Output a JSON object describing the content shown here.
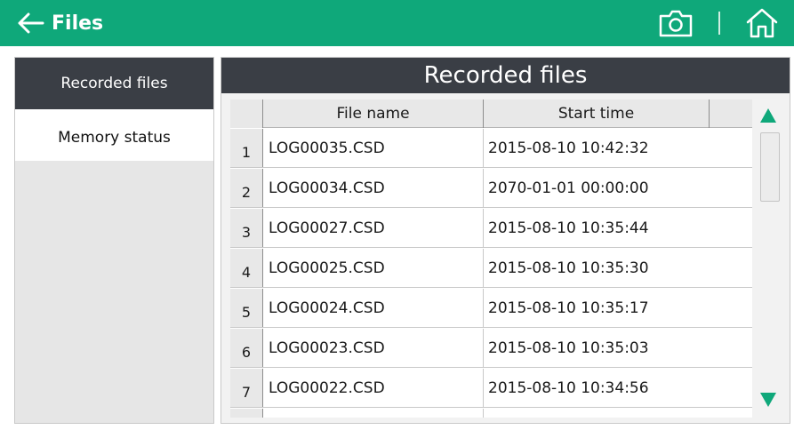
{
  "header": {
    "title": "Files",
    "back_icon": "arrow-left-icon",
    "camera_icon": "camera-icon",
    "home_icon": "home-icon",
    "bg_color": "#0fa87a"
  },
  "sidebar": {
    "items": [
      {
        "label": "Recorded files",
        "active": true
      },
      {
        "label": "Memory status",
        "active": false
      }
    ]
  },
  "main": {
    "title": "Recorded files",
    "table": {
      "columns": [
        "File name",
        "Start time"
      ],
      "rows": [
        {
          "num": "1",
          "file": "LOG00035.CSD",
          "start": "2015-08-10 10:42:32"
        },
        {
          "num": "2",
          "file": "LOG00034.CSD",
          "start": "2070-01-01 00:00:00"
        },
        {
          "num": "3",
          "file": "LOG00027.CSD",
          "start": "2015-08-10 10:35:44"
        },
        {
          "num": "4",
          "file": "LOG00025.CSD",
          "start": "2015-08-10 10:35:30"
        },
        {
          "num": "5",
          "file": "LOG00024.CSD",
          "start": "2015-08-10 10:35:17"
        },
        {
          "num": "6",
          "file": "LOG00023.CSD",
          "start": "2015-08-10 10:35:03"
        },
        {
          "num": "7",
          "file": "LOG00022.CSD",
          "start": "2015-08-10 10:34:56"
        }
      ]
    },
    "scroll": {
      "up_icon": "triangle-up-icon",
      "down_icon": "triangle-down-icon",
      "arrow_color": "#0fa87a"
    }
  }
}
